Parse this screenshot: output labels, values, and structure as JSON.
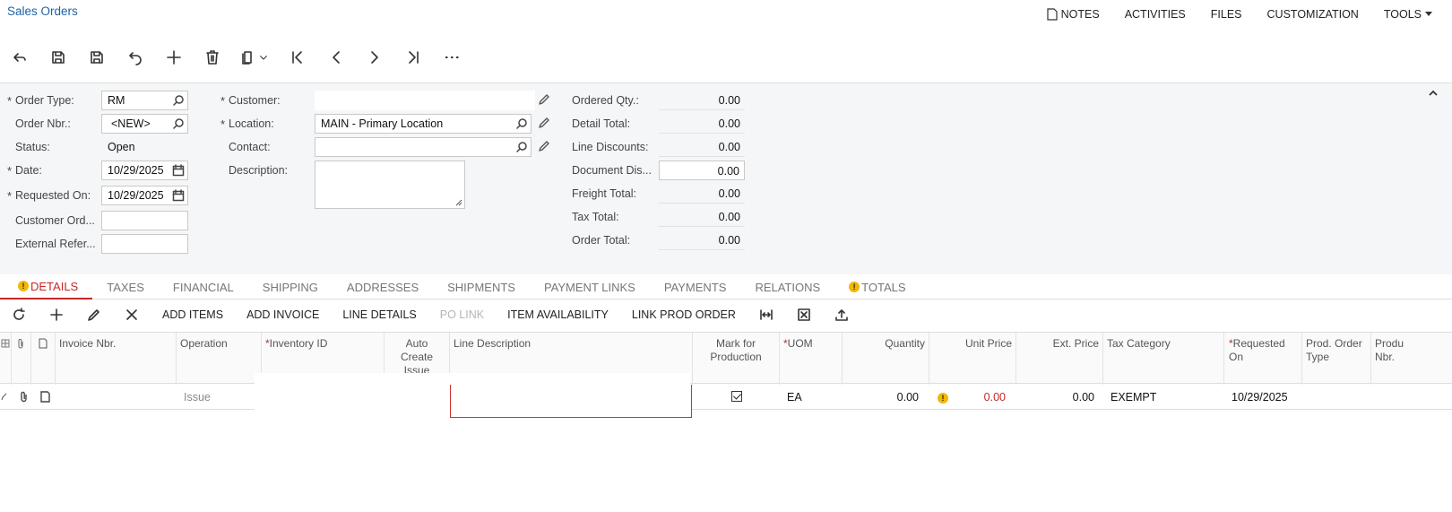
{
  "header": {
    "breadcrumb": "Sales Orders",
    "menu": [
      "NOTES",
      "ACTIVITIES",
      "FILES",
      "CUSTOMIZATION",
      "TOOLS"
    ]
  },
  "toolbar": {
    "icons": [
      "back-icon",
      "save-close-icon",
      "save-icon",
      "undo-icon",
      "add-icon",
      "delete-icon",
      "copy-paste-icon",
      "first-icon",
      "prev-icon",
      "next-icon",
      "last-icon",
      "more-icon"
    ]
  },
  "form": {
    "order_type": {
      "label": "Order Type:",
      "value": "RM"
    },
    "order_nbr": {
      "label": "Order Nbr.:",
      "value": "<NEW>"
    },
    "status": {
      "label": "Status:",
      "value": "Open"
    },
    "date": {
      "label": "Date:",
      "value": "10/29/2025"
    },
    "requested_on": {
      "label": "Requested On:",
      "value": "10/29/2025"
    },
    "customer_order": {
      "label": "Customer Ord...",
      "value": ""
    },
    "external_ref": {
      "label": "External Refer...",
      "value": ""
    },
    "customer": {
      "label": "Customer:",
      "value": ""
    },
    "location": {
      "label": "Location:",
      "value": "MAIN - Primary Location"
    },
    "contact": {
      "label": "Contact:",
      "value": ""
    },
    "description": {
      "label": "Description:",
      "value": ""
    },
    "totals": [
      {
        "label": "Ordered Qty.:",
        "value": "0.00"
      },
      {
        "label": "Detail Total:",
        "value": "0.00"
      },
      {
        "label": "Line Discounts:",
        "value": "0.00"
      },
      {
        "label": "Document Dis...",
        "value": "0.00"
      },
      {
        "label": "Freight Total:",
        "value": "0.00"
      },
      {
        "label": "Tax Total:",
        "value": "0.00"
      },
      {
        "label": "Order Total:",
        "value": "0.00"
      }
    ]
  },
  "tabs": [
    "DETAILS",
    "TAXES",
    "FINANCIAL",
    "SHIPPING",
    "ADDRESSES",
    "SHIPMENTS",
    "PAYMENT LINKS",
    "PAYMENTS",
    "RELATIONS",
    "TOTALS"
  ],
  "grid_toolbar": {
    "buttons": [
      "ADD ITEMS",
      "ADD INVOICE",
      "LINE DETAILS",
      "PO LINK",
      "ITEM AVAILABILITY",
      "LINK PROD ORDER"
    ]
  },
  "grid": {
    "columns": [
      "Invoice Nbr.",
      "Operation",
      "Inventory ID",
      "Auto Create Issue",
      "Line Description",
      "Mark for Production",
      "UOM",
      "Quantity",
      "Unit Price",
      "Ext. Price",
      "Tax Category",
      "Requested On",
      "Prod. Order Type",
      "Produ Nbr."
    ],
    "row": {
      "operation": "Issue",
      "uom": "EA",
      "quantity": "0.00",
      "unit_price": "0.00",
      "ext_price": "0.00",
      "tax_category": "EXEMPT",
      "requested_on": "10/29/2025"
    }
  }
}
